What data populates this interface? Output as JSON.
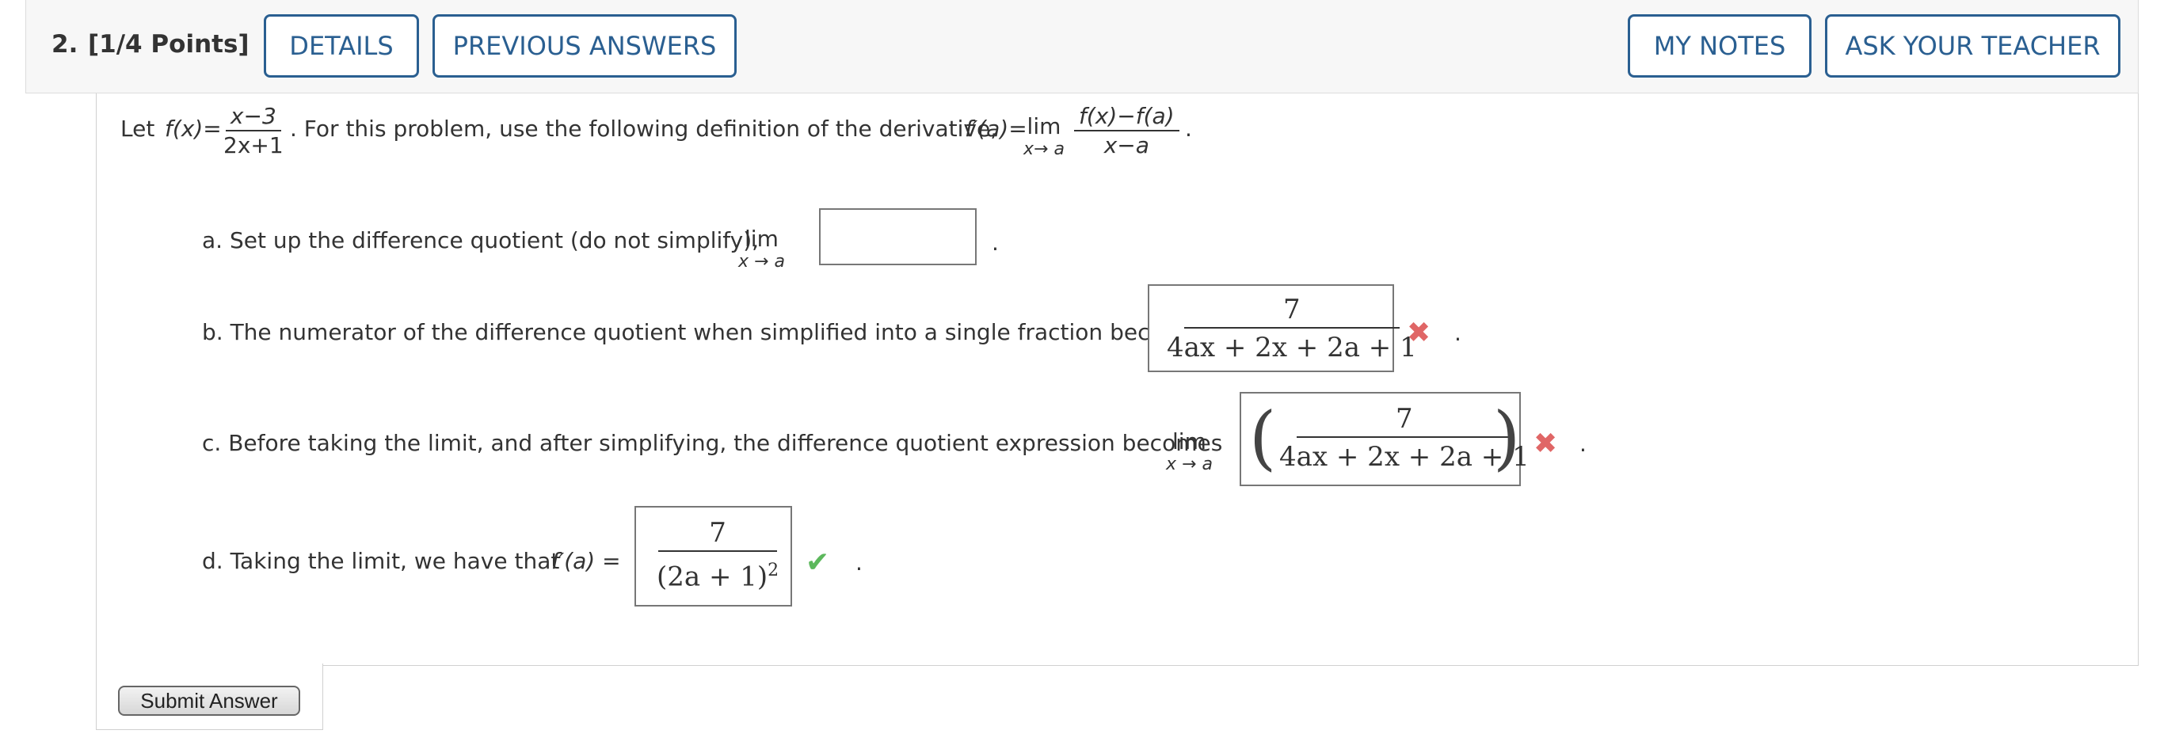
{
  "header": {
    "number": "2.",
    "points": "[1/4 Points]",
    "details_label": "DETAILS",
    "previous_label": "PREVIOUS ANSWERS",
    "notes_label": "MY NOTES",
    "teacher_label": "ASK YOUR TEACHER"
  },
  "problem": {
    "let": "Let",
    "f_of_x": "f(x)=",
    "f_num": "x−3",
    "f_den": "2x+1",
    "middle": ". For this problem, use the following definition of the derivative,",
    "fprime_a": "f′(a)=",
    "lim": "lim",
    "lim_sub": "x→ a",
    "def_num": "f(x)−f(a)",
    "def_den": "x−a",
    "end": "."
  },
  "parts": {
    "a": {
      "text": "a. Set up the difference quotient (do not simplify),",
      "lim": "lim",
      "lim_sub": "x → a",
      "value": "",
      "end": "."
    },
    "b": {
      "text": "b. The numerator of the difference quotient when simplified into a single fraction becomes",
      "ans_num": "7",
      "ans_den": "4ax + 2x + 2a + 1",
      "status": "incorrect",
      "mark": "✖",
      "end": "."
    },
    "c": {
      "text": "c. Before taking the limit, and after simplifying, the difference quotient expression becomes",
      "lim": "lim",
      "lim_sub": "x → a",
      "paren_open": "(",
      "paren_close": ")",
      "ans_num": "7",
      "ans_den": "4ax + 2x + 2a + 1",
      "status": "incorrect",
      "mark": "✖",
      "end": "."
    },
    "d": {
      "text": "d. Taking the limit, we have that",
      "fprime": "f′(a) =",
      "ans_num": "7",
      "ans_den_base": "(2a + 1)",
      "ans_den_exp": "2",
      "status": "correct",
      "mark": "✔",
      "end": "."
    }
  },
  "submit_label": "Submit Answer",
  "colors": {
    "accent": "#2a5f91",
    "incorrect": "#e06666",
    "correct": "#5cb85c"
  }
}
